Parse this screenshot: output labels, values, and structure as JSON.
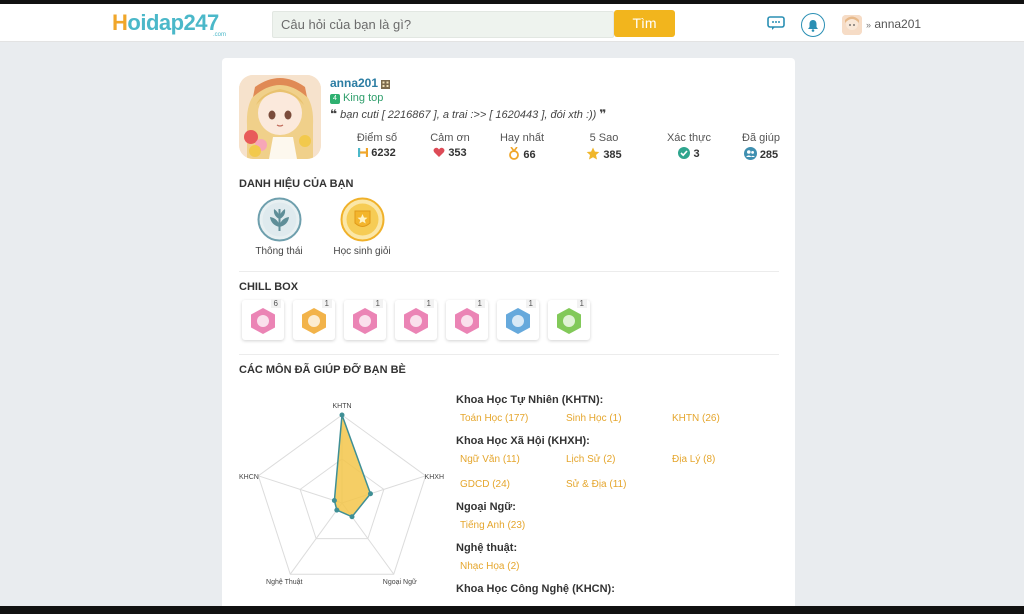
{
  "header": {
    "logo_main": "oidap247",
    "logo_h": "H",
    "logo_sub": ".com",
    "search_placeholder": "Câu hỏi của bạn là gì?",
    "search_button": "Tìm",
    "username": "anna201"
  },
  "profile": {
    "username": "anna201",
    "rank_num": "4",
    "rank": "King top",
    "quote": "bạn cuti  [ 2216867 ],  a trai :>> [ 1620443 ], đói xth :))"
  },
  "stats": [
    {
      "label": "Điểm số",
      "value": "6232",
      "icon": "h-icon"
    },
    {
      "label": "Cảm ơn",
      "value": "353",
      "icon": "heart-icon"
    },
    {
      "label": "Hay nhất",
      "value": "66",
      "icon": "medal-icon"
    },
    {
      "label": "5 Sao",
      "value": "385",
      "icon": "star-icon"
    },
    {
      "label": "Xác thực",
      "value": "3",
      "icon": "check-icon"
    },
    {
      "label": "Đã giúp",
      "value": "285",
      "icon": "users-icon"
    }
  ],
  "titles_section": {
    "heading": "DANH HIỆU CỦA BẠN",
    "items": [
      {
        "label": "Thông thái",
        "icon": "laurel-icon"
      },
      {
        "label": "Học sinh giỏi",
        "icon": "star-medal-icon"
      }
    ]
  },
  "chill_box": {
    "heading": "CHILL BOX",
    "items": [
      {
        "count": "6",
        "icon": "egg-icon",
        "color": "#e86fa8"
      },
      {
        "count": "1",
        "icon": "crown-flower-icon",
        "color": "#f0a62a"
      },
      {
        "count": "1",
        "icon": "flower-icon",
        "color": "#e86fa8"
      },
      {
        "count": "1",
        "icon": "cake-icon",
        "color": "#e86fa8"
      },
      {
        "count": "1",
        "icon": "cup-icon",
        "color": "#e86fa8"
      },
      {
        "count": "1",
        "icon": "trophy-icon",
        "color": "#4b9ad6"
      },
      {
        "count": "1",
        "icon": "ribbon-icon",
        "color": "#6cbf3c"
      }
    ]
  },
  "subjects_section": {
    "heading": "CÁC MÔN ĐÃ GIÚP ĐỠ BẠN BÈ",
    "groups": [
      {
        "name": "Khoa Học Tự Nhiên (KHTN):",
        "items": [
          "Toán Học (177)",
          "Sinh Học (1)",
          "KHTN (26)"
        ]
      },
      {
        "name": "Khoa Học Xã Hội (KHXH):",
        "items": [
          "Ngữ Văn (11)",
          "Lịch Sử (2)",
          "Địa Lý (8)",
          "GDCD (24)",
          "Sử & Địa (11)"
        ]
      },
      {
        "name": "Ngoại Ngữ:",
        "items": [
          "Tiếng Anh (23)"
        ]
      },
      {
        "name": "Nghệ thuật:",
        "items": [
          "Nhạc Họa (2)"
        ]
      },
      {
        "name": "Khoa Học Công Nghệ (KHCN):",
        "items": []
      }
    ]
  },
  "chart_data": {
    "type": "radar",
    "axes": [
      "KHTN",
      "KHXH",
      "Ngoại Ngữ",
      "Nghệ Thuật",
      "KHCN"
    ],
    "values": [
      204,
      56,
      23,
      2,
      0
    ],
    "max": 204
  },
  "colors": {
    "accent": "#f2b51d",
    "link": "#2b7da3",
    "subject": "#e5a62d",
    "radar_fill": "#f3c64a",
    "radar_line": "#3f8f95"
  }
}
